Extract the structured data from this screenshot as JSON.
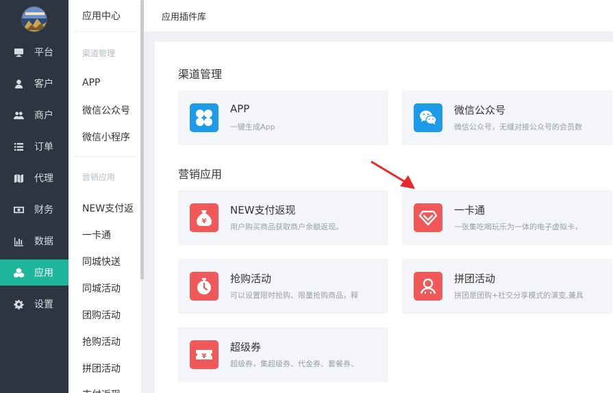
{
  "nav": {
    "items": [
      {
        "label": "平台",
        "icon": "monitor-icon"
      },
      {
        "label": "客户",
        "icon": "user-icon"
      },
      {
        "label": "商户",
        "icon": "users-icon"
      },
      {
        "label": "订单",
        "icon": "list-icon"
      },
      {
        "label": "代理",
        "icon": "map-icon"
      },
      {
        "label": "财务",
        "icon": "money-icon"
      },
      {
        "label": "数据",
        "icon": "bar-chart-icon"
      },
      {
        "label": "应用",
        "icon": "cubes-icon",
        "active": true
      },
      {
        "label": "设置",
        "icon": "gear-icon"
      }
    ],
    "active_color": "#1fb79b",
    "bg_color": "#2c3540"
  },
  "sub": {
    "title": "应用中心",
    "group1": "渠道管理",
    "group1_items": [
      "APP",
      "微信公众号",
      "微信小程序"
    ],
    "group2": "营销应用",
    "group2_items": [
      "NEW支付返",
      "一卡通",
      "同城快送",
      "同城活动",
      "团购活动",
      "抢购活动",
      "拼团活动",
      "支付返现"
    ]
  },
  "topbar": {
    "breadcrumb": "应用插件库"
  },
  "main": {
    "section1": "渠道管理",
    "section2": "营销应用",
    "cards": [
      {
        "title": "APP",
        "desc": "一键生成App",
        "icon": "app-grid-icon",
        "color": "#1e9be8"
      },
      {
        "title": "微信公众号",
        "desc": "微信公众号，无缝对接公众号的会员数",
        "icon": "wechat-icon",
        "color": "#1e9be8"
      },
      {
        "title": "NEW支付返现",
        "desc": "用户购买商品获取商户余额返现。",
        "icon": "money-bag-icon",
        "color": "#f1585a"
      },
      {
        "title": "一卡通",
        "desc": "一张集吃喝玩乐为一体的电子虚拟卡，",
        "icon": "diamond-icon",
        "color": "#f1585a"
      },
      {
        "title": "抢购活动",
        "desc": "可以设置限时抢购、限量抢购商品，释",
        "icon": "stopwatch-icon",
        "color": "#f1585a"
      },
      {
        "title": "拼团活动",
        "desc": "拼团是团购+社交分享模式的演变,兼具",
        "icon": "group-icon",
        "color": "#f1585a"
      },
      {
        "title": "超级券",
        "desc": "超级券，集超级券、代金券、套餐券、",
        "icon": "coupon-icon",
        "color": "#f1585a"
      }
    ]
  }
}
